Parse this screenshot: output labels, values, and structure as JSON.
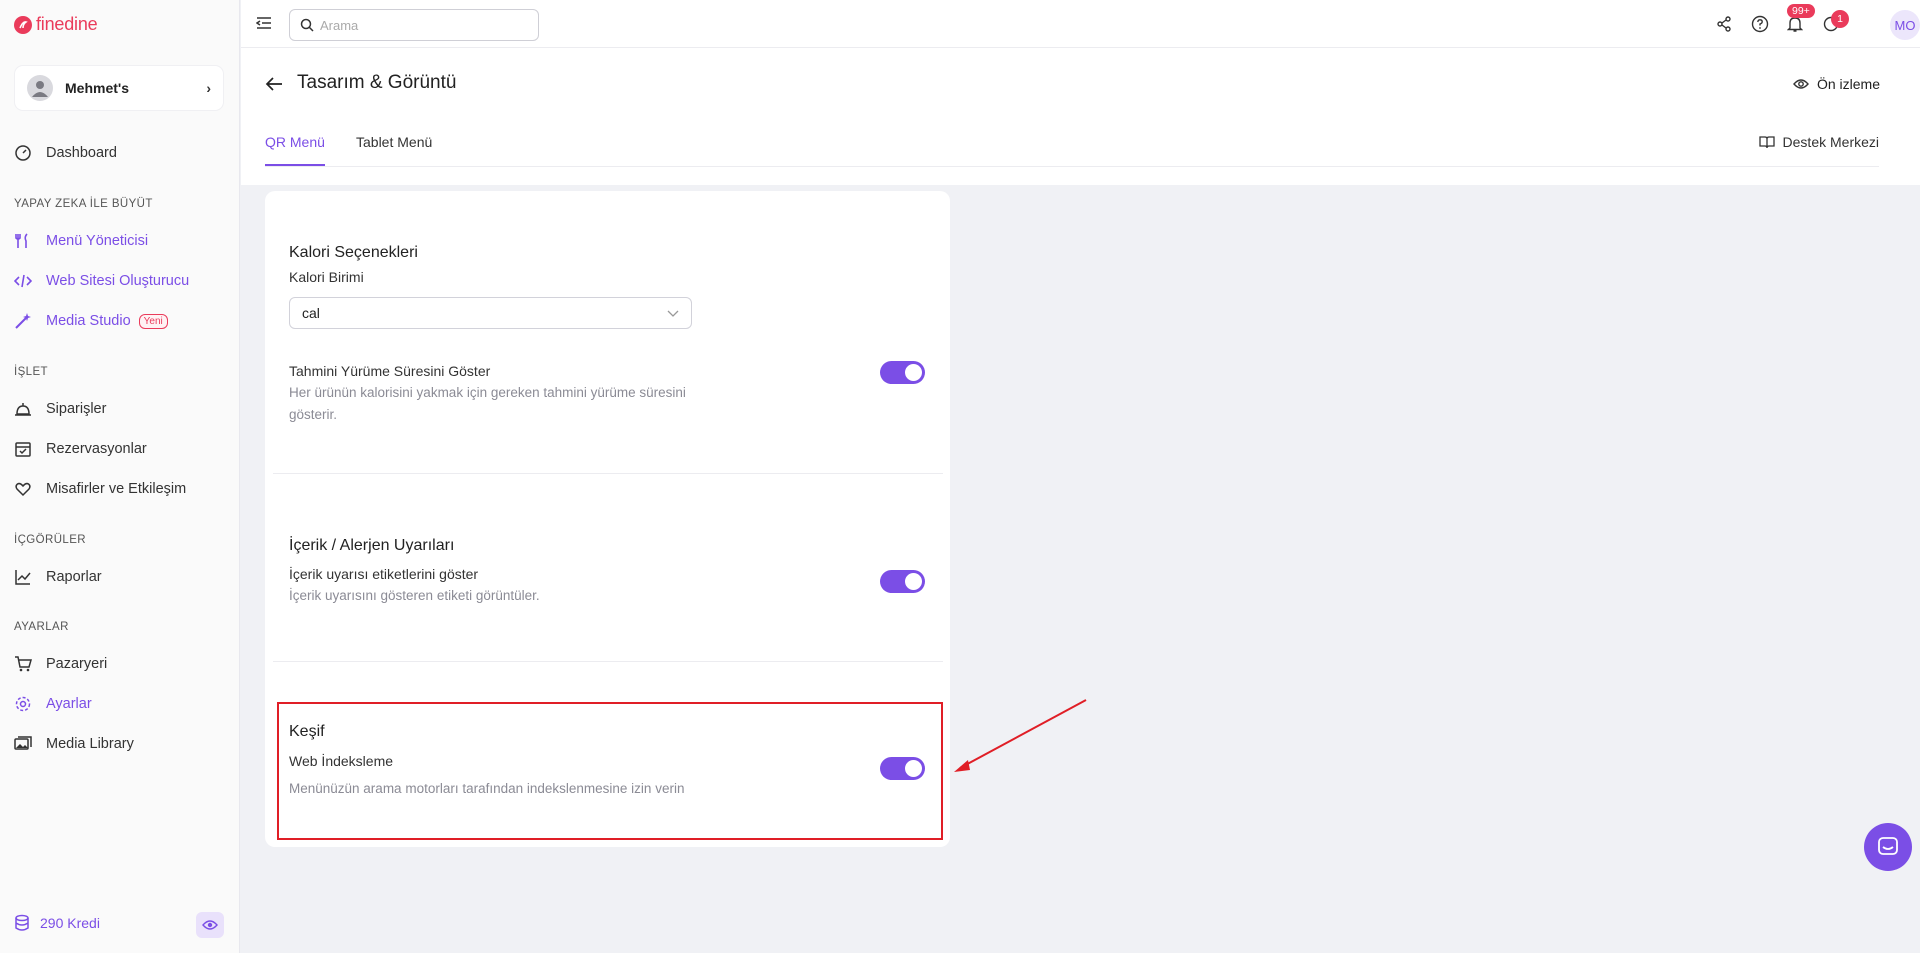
{
  "brand": {
    "logo_text": "finedine",
    "accent": "#7b4ee6",
    "brand_red": "#ea3b5b"
  },
  "venue": {
    "name": "Mehmet's"
  },
  "sidebar": {
    "dashboard": "Dashboard",
    "section_ai": "YAPAY ZEKA İLE BÜYÜT",
    "menu_manager": "Menü Yöneticisi",
    "website_builder": "Web Sitesi Oluşturucu",
    "media_studio": "Media Studio",
    "media_studio_badge": "Yeni",
    "section_operate": "İŞLET",
    "orders": "Siparişler",
    "reservations": "Rezervasyonlar",
    "guests": "Misafirler ve Etkileşim",
    "section_insights": "İÇGÖRÜLER",
    "reports": "Raporlar",
    "section_settings": "AYARLAR",
    "marketplace": "Pazaryeri",
    "settings": "Ayarlar",
    "media_library": "Media Library",
    "credits": "290 Kredi"
  },
  "topbar": {
    "search_placeholder": "Arama",
    "notifications_count": "99+",
    "updates_count": "1",
    "user_initials": "MO"
  },
  "header": {
    "title": "Tasarım & Görüntü",
    "preview_label": "Ön izleme",
    "tabs": [
      {
        "label": "QR Menü"
      },
      {
        "label": "Tablet Menü"
      }
    ],
    "support_label": "Destek Merkezi"
  },
  "card": {
    "calorie": {
      "title": "Kalori Seçenekleri",
      "unit_label": "Kalori Birimi",
      "unit_value": "cal",
      "walk_label": "Tahmini Yürüme Süresini Göster",
      "walk_desc_1": "Her ürünün kalorisini yakmak için gereken tahmini yürüme süresini",
      "walk_desc_2": "gösterir.",
      "walk_enabled": true
    },
    "allergen": {
      "title": "İçerik / Alerjen Uyarıları",
      "label": "İçerik uyarısı etiketlerini göster",
      "desc": "İçerik uyarısını gösteren etiketi görüntüler.",
      "enabled": true
    },
    "discovery": {
      "title": "Keşif",
      "label": "Web İndeksleme",
      "desc": "Menünüzün arama motorları tarafından indekslenmesine izin verin",
      "enabled": true
    }
  },
  "annotation": {
    "highlight_color": "#e01e26"
  }
}
